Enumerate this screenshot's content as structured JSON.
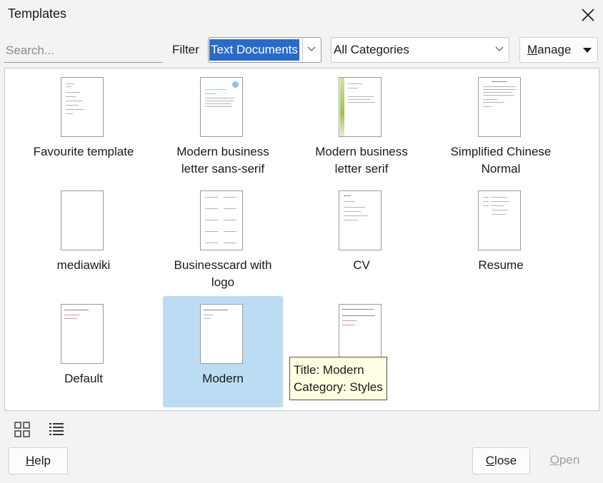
{
  "window": {
    "title": "Templates"
  },
  "toolbar": {
    "search_placeholder": "Search...",
    "filter_label": "Filter",
    "filter_value": "Text Documents",
    "category_value": "All Categories",
    "manage_accel": "M",
    "manage_rest": "anage"
  },
  "templates": [
    {
      "label": "Favourite template"
    },
    {
      "label": "Modern business letter sans-serif"
    },
    {
      "label": "Modern business letter serif"
    },
    {
      "label": "Simplified Chinese Normal"
    },
    {
      "label": "mediawiki"
    },
    {
      "label": "Businesscard with logo"
    },
    {
      "label": "CV"
    },
    {
      "label": "Resume"
    },
    {
      "label": "Default"
    },
    {
      "label": "Modern",
      "selected": true
    },
    {
      "label": ""
    }
  ],
  "tooltip": {
    "title_line": "Title: Modern",
    "category_line": "Category: Styles"
  },
  "footer": {
    "help_accel": "H",
    "help_rest": "elp",
    "close_accel": "C",
    "close_rest": "lose",
    "open_accel": "O",
    "open_rest": "pen"
  },
  "colors": {
    "selection": "#bcdcf4",
    "filter_highlight": "#2a6ac9",
    "tooltip_bg": "#ffffe1"
  },
  "icons": {
    "close": "close-icon",
    "thumbnail_view": "thumbnail-view-icon",
    "list_view": "list-view-icon"
  }
}
